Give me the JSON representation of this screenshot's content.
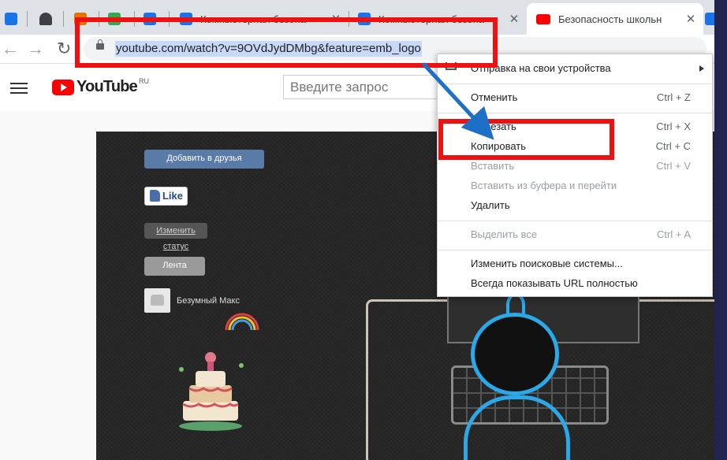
{
  "tabs": [
    {
      "title": "",
      "favicon_color": "#1a73e8"
    },
    {
      "title": "",
      "favicon_color": "#3c4043"
    },
    {
      "title": "",
      "favicon_color": "#e37400"
    },
    {
      "title": "",
      "favicon_color": "#34a853"
    },
    {
      "title": "",
      "favicon_color": "#1a73e8"
    },
    {
      "title": "Компьютерная безопа",
      "favicon_color": "#1a73e8"
    },
    {
      "title": "Компьютерная безопа",
      "favicon_color": "#1a73e8"
    },
    {
      "title": "Безопасность школьн",
      "favicon_color": "#ff0000",
      "active": true
    },
    {
      "title": "",
      "favicon_color": "#1a73e8"
    }
  ],
  "toolbar": {
    "back_icon": "back-arrow-icon",
    "forward_icon": "forward-arrow-icon",
    "reload_icon": "reload-icon",
    "url": "youtube.com/watch?v=9OVdJydDMbg&feature=emb_logo"
  },
  "youtube": {
    "logo_text": "YouTube",
    "region": "RU",
    "search_placeholder": "Введите запрос"
  },
  "video": {
    "add_friend": "Добавить в друзья",
    "like": "Like",
    "change_status": "Изменить статус",
    "feed": "Лента",
    "username": "Безумный Макс"
  },
  "context_menu": {
    "send": "Отправка на свои устройства",
    "undo": {
      "label": "Отменить",
      "shortcut": "Ctrl + Z"
    },
    "cut": {
      "label": "Вырезать",
      "shortcut": "Ctrl + X"
    },
    "copy": {
      "label": "Копировать",
      "shortcut": "Ctrl + C"
    },
    "paste": {
      "label": "Вставить",
      "shortcut": "Ctrl + V"
    },
    "paste_go": {
      "label": "Вставить из буфера и перейти"
    },
    "delete": {
      "label": "Удалить"
    },
    "select_all": {
      "label": "Выделить все",
      "shortcut": "Ctrl + A"
    },
    "search_engines": "Изменить поисковые системы...",
    "show_url": "Всегда показывать URL полностью"
  },
  "colors": {
    "annotation_red": "#ee1111",
    "annotation_arrow": "#1e6fc8"
  }
}
